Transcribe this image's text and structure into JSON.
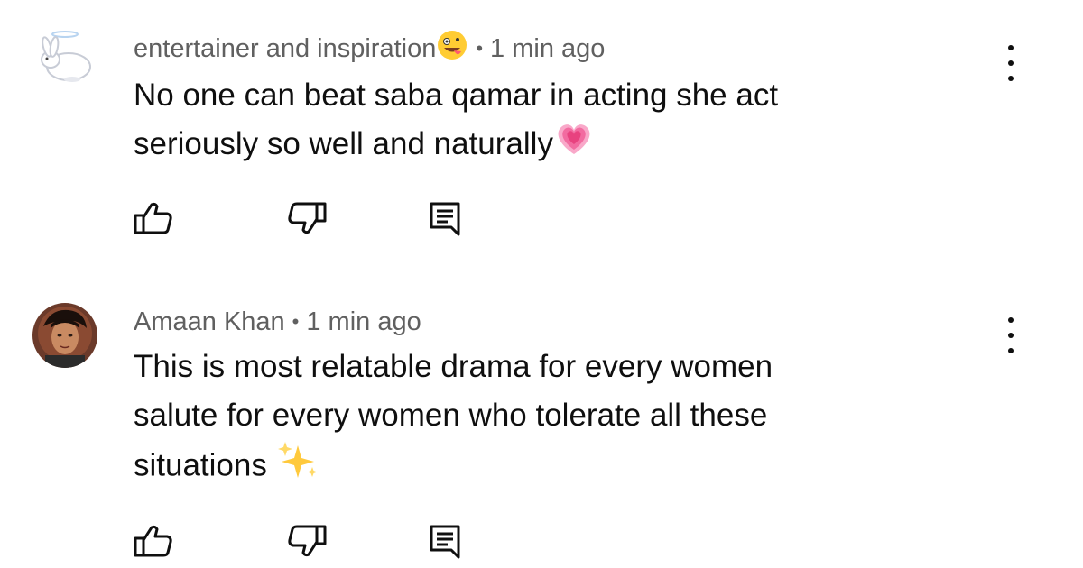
{
  "comments": [
    {
      "author": "entertainer and  inspiration",
      "author_emoji": "zany-face-emoji",
      "separator": "•",
      "time": "1 min ago",
      "lines": [
        "No one can beat saba qamar in acting she act",
        "seriously so well and naturally"
      ],
      "trailing_emoji": "growing-heart-emoji",
      "avatar": "bunny-angel-avatar"
    },
    {
      "author": "Amaan Khan",
      "separator": "•",
      "time": "1 min ago",
      "lines": [
        "This is most relatable drama for every women",
        "salute for every women who tolerate all these",
        "situations "
      ],
      "trailing_emoji": "sparkles-emoji",
      "avatar": "profile-photo-avatar"
    }
  ],
  "icons": {
    "like": "thumbs-up-icon",
    "dislike": "thumbs-down-icon",
    "reply": "reply-icon",
    "more": "more-vertical-icon"
  },
  "colors": {
    "meta": "#606060",
    "text": "#0f0f0f",
    "background": "#ffffff"
  }
}
